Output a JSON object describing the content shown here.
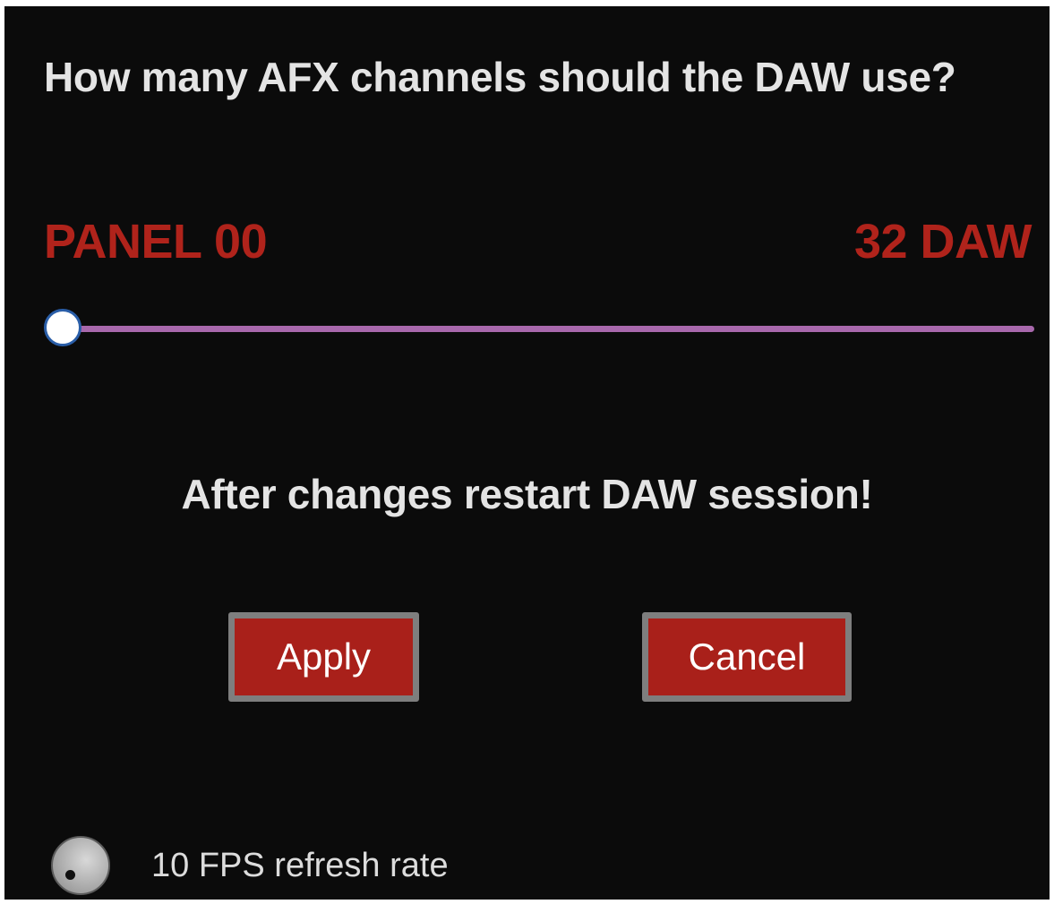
{
  "dialog": {
    "question": "How many AFX channels should the DAW use?",
    "range_min_label": "PANEL 00",
    "range_max_label": "32 DAW",
    "slider": {
      "value_fraction": 0.0,
      "track_color": "#a868ac",
      "thumb_border_color": "#2a5ea8"
    },
    "warning": "After changes restart DAW session!",
    "apply_label": "Apply",
    "cancel_label": "Cancel",
    "fps_label": "10 FPS refresh rate",
    "colors": {
      "accent_red": "#b0231b",
      "button_fill": "#a9201a",
      "button_border": "#7e7e7e",
      "background": "#0b0b0b",
      "text": "#e4e4e4"
    },
    "icons": {
      "slider_thumb": "slider-thumb-icon",
      "fps_knob": "knob-icon"
    }
  }
}
